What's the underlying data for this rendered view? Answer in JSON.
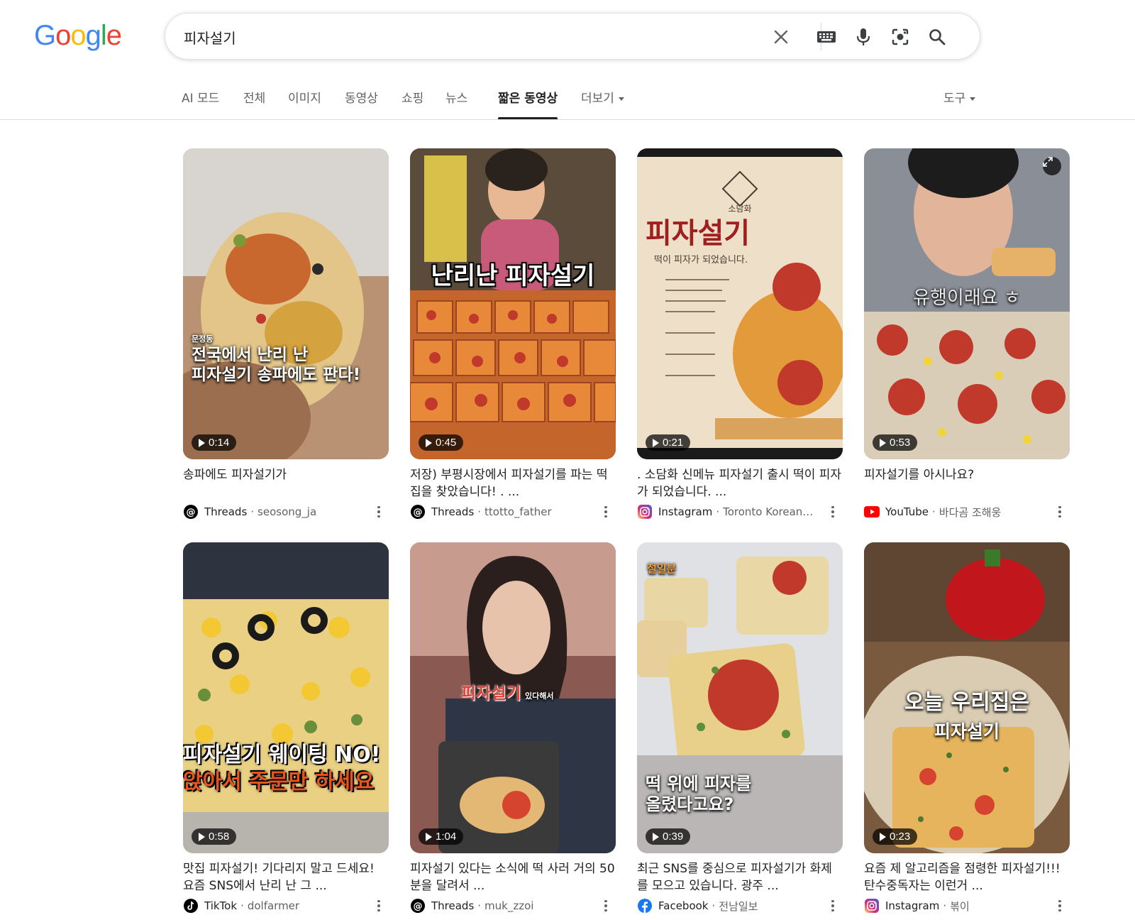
{
  "logo": {
    "letters": [
      "G",
      "o",
      "o",
      "g",
      "l",
      "e"
    ],
    "colors": [
      "#4285F4",
      "#EA4335",
      "#FBBC05",
      "#4285F4",
      "#34A853",
      "#EA4335"
    ]
  },
  "search": {
    "query": "피자설기"
  },
  "tabs": [
    {
      "label": "AI 모드"
    },
    {
      "label": "전체"
    },
    {
      "label": "이미지"
    },
    {
      "label": "동영상"
    },
    {
      "label": "쇼핑"
    },
    {
      "label": "뉴스"
    },
    {
      "label": "짧은 동영상",
      "active": true
    },
    {
      "label": "더보기"
    }
  ],
  "tools_label": "도구",
  "videos": [
    {
      "overlay_small": "문정동",
      "overlay": "전국에서 난리 난\n피자설기 송파에도 판다!",
      "duration": "0:14",
      "title": "송파에도 피자설기가",
      "source": "Threads",
      "author": "seosong_ja",
      "icon": "threads-icon"
    },
    {
      "overlay": "난리난 피자설기",
      "duration": "0:45",
      "title": "저장) 부평시장에서 피자설기를 파는 떡집을 찾았습니다! . ...",
      "source": "Threads",
      "author": "ttotto_father",
      "icon": "threads-icon"
    },
    {
      "overlay_brand": "소담화",
      "overlay": "피자설기",
      "overlay_sub": "떡이 피자가 되었습니다.",
      "duration": "0:21",
      "title": ". 소담화 신메뉴 피자설기 출시 떡이 피자가 되었습니다. ...",
      "source": "Instagram",
      "author": "Toronto Korean D...",
      "icon": "instagram-icon"
    },
    {
      "overlay": "유행이래요 ㅎ",
      "duration": "0:53",
      "title": "피자설기를 아시나요?",
      "source": "YouTube",
      "author": "바다곰 조해웅",
      "icon": "youtube-icon"
    },
    {
      "overlay": "피자설기 웨이팅 NO!",
      "overlay2": "앉아서 주문만 하세요",
      "duration": "0:58",
      "title": "맛집 피자설기! 기다리지 말고 드세요! 요즘 SNS에서 난리 난 그 ...",
      "source": "TikTok",
      "author": "dolfarmer",
      "icon": "tiktok-icon"
    },
    {
      "overlay": "피자설기",
      "overlay_small": "있다해서",
      "duration": "1:04",
      "title": "피자설기 있다는 소식에 떡 사러 거의 50분을 달려서 ...",
      "source": "Threads",
      "author": "muk_zzoi",
      "icon": "threads-icon"
    },
    {
      "overlay_small": "절일분",
      "overlay": "떡 위에 피자를\n올렸다고요?",
      "duration": "0:39",
      "title": "최근 SNS를 중심으로 피자설기가 화제를 모으고 있습니다. 광주 ...",
      "source": "Facebook",
      "author": "전남일보",
      "icon": "facebook-icon"
    },
    {
      "overlay": "오늘 우리집은",
      "overlay2": "피자설기",
      "duration": "0:23",
      "title": "요즘 제 알고리즘을 점령한 피자설기!!! 탄수중독자는 이런거 ...",
      "source": "Instagram",
      "author": "볶이",
      "icon": "instagram-icon"
    }
  ]
}
